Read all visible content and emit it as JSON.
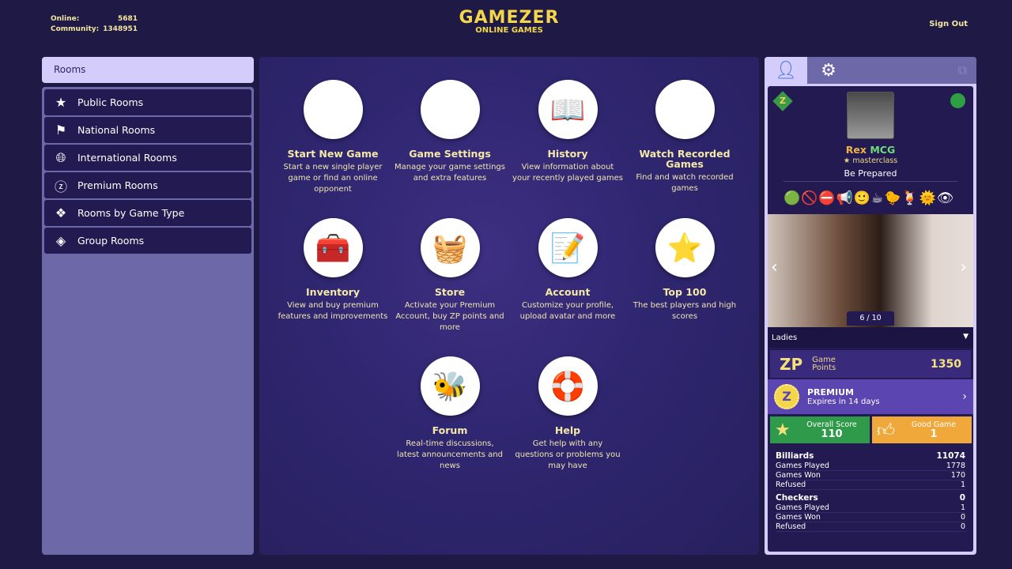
{
  "header": {
    "online_label": "Online:",
    "online": "5681",
    "community_label": "Community:",
    "community": "1348951",
    "logo_title": "GAMEZER",
    "logo_sub": "ONLINE GAMES",
    "sign_out": "Sign Out"
  },
  "sidebar": {
    "title": "Rooms",
    "items": [
      {
        "label": "Public Rooms",
        "icon": "star-icon"
      },
      {
        "label": "National Rooms",
        "icon": "flag-icon"
      },
      {
        "label": "International Rooms",
        "icon": "globe-icon"
      },
      {
        "label": "Premium Rooms",
        "icon": "premium-z-icon"
      },
      {
        "label": "Rooms by Game Type",
        "icon": "diamonds-icon"
      },
      {
        "label": "Group Rooms",
        "icon": "group-z-icon"
      }
    ]
  },
  "tiles": [
    {
      "title": "Start New Game",
      "desc": "Start a new single player game or find an online opponent",
      "icon": "✈"
    },
    {
      "title": "Game Settings",
      "desc": "Manage your game settings and extra features",
      "icon": "🛠"
    },
    {
      "title": "History",
      "desc": "View information about your recently played games",
      "icon": "📖"
    },
    {
      "title": "Watch Recorded Games",
      "desc": "Find and watch recorded games",
      "icon": "🎞"
    },
    {
      "title": "Inventory",
      "desc": "View and buy premium features and improvements",
      "icon": "🧰"
    },
    {
      "title": "Store",
      "desc": "Activate your Premium Account, buy ZP points and more",
      "icon": "🧺"
    },
    {
      "title": "Account",
      "desc": "Customize your profile, upload avatar and more",
      "icon": "📝"
    },
    {
      "title": "Top 100",
      "desc": "The best players and high scores",
      "icon": "⭐"
    },
    {
      "title": "Forum",
      "desc": "Real-time discussions, latest announcements and news",
      "icon": "🐝"
    },
    {
      "title": "Help",
      "desc": "Get help with any questions or problems you may have",
      "icon": "🛟"
    }
  ],
  "profile": {
    "name_first": "Rex",
    "name_second": "MCG",
    "rank": "★ masterclass",
    "motto": "Be Prepared",
    "status_color": "#2ea043",
    "emoticons": [
      "🟢",
      "🚫",
      "⛔",
      "📢",
      "🙂",
      "☕",
      "🐤",
      "🍹",
      "🌞",
      "👁"
    ],
    "photo_counter": "6 / 10",
    "category": "Ladies",
    "zp_label": "ZP",
    "zp_text1": "Game",
    "zp_text2": "Points",
    "zp_value": "1350",
    "premium_title": "PREMIUM",
    "premium_expiry": "Expires in 14  days",
    "overall_label": "Overall Score",
    "overall_value": "110",
    "good_label": "Good Game",
    "good_value": "1",
    "stats": [
      {
        "game": "Billiards",
        "score": "11074",
        "rows": [
          [
            "Games Played",
            "1778"
          ],
          [
            "Games Won",
            "170"
          ],
          [
            "Refused",
            "1"
          ]
        ]
      },
      {
        "game": "Checkers",
        "score": "0",
        "rows": [
          [
            "Games Played",
            "1"
          ],
          [
            "Games Won",
            "0"
          ],
          [
            "Refused",
            "0"
          ]
        ]
      }
    ]
  }
}
